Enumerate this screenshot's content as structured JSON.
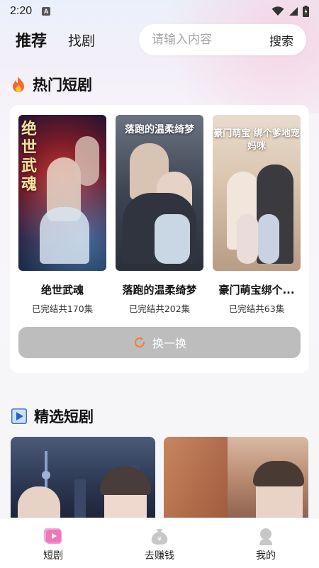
{
  "status_bar": {
    "time": "2:20",
    "notif_letter": "A"
  },
  "top_nav": {
    "tab_recommend": "推荐",
    "tab_find": "找剧",
    "search_placeholder": "请输入内容",
    "search_button": "搜索"
  },
  "hot_section": {
    "title": "热门短剧",
    "dramas": [
      {
        "name": "绝世武魂",
        "status": "已完结共170集",
        "poster_text": "绝世武魂"
      },
      {
        "name": "落跑的温柔绮梦",
        "status": "已完结共202集",
        "poster_text": "落跑的温柔绮梦"
      },
      {
        "name": "豪门萌宝绑个...",
        "status": "已完结共63集",
        "poster_text": "豪门萌宝 绑个爹地宠妈咪"
      }
    ],
    "refresh_label": "换一换"
  },
  "featured_section": {
    "title": "精选短剧"
  },
  "bottom_nav": {
    "items": [
      {
        "label": "短剧"
      },
      {
        "label": "去赚钱"
      },
      {
        "label": "我的"
      }
    ]
  },
  "colors": {
    "accent_orange": "#f0803c",
    "refresh_bg": "#bdbdbd"
  }
}
